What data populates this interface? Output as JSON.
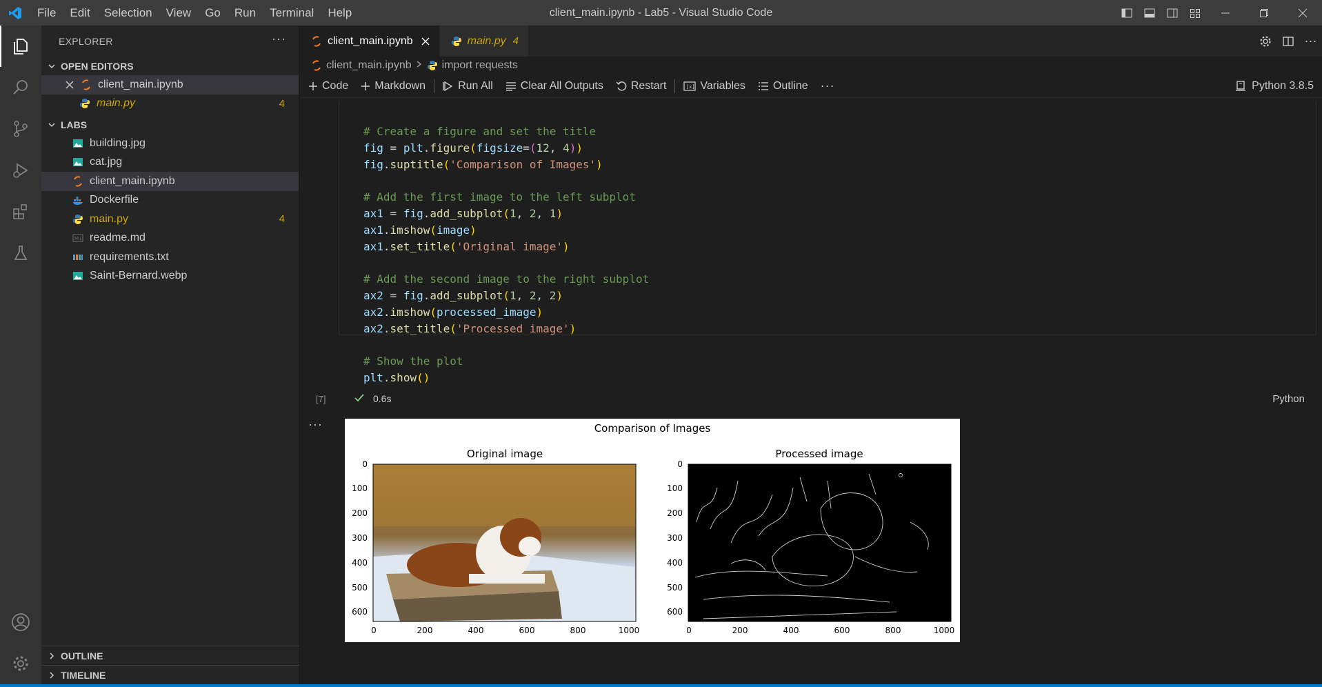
{
  "window": {
    "title": "client_main.ipynb - Lab5 - Visual Studio Code",
    "menu": [
      "File",
      "Edit",
      "Selection",
      "View",
      "Go",
      "Run",
      "Terminal",
      "Help"
    ]
  },
  "sidebar": {
    "title": "EXPLORER",
    "open_editors": {
      "label": "OPEN EDITORS",
      "items": [
        {
          "label": "client_main.ipynb",
          "icon": "notebook-icon"
        },
        {
          "label": "main.py",
          "icon": "python-icon",
          "badge": "4"
        }
      ]
    },
    "folder": {
      "label": "LABS",
      "items": [
        {
          "label": "building.jpg",
          "icon": "image-icon"
        },
        {
          "label": "cat.jpg",
          "icon": "image-icon"
        },
        {
          "label": "client_main.ipynb",
          "icon": "notebook-icon"
        },
        {
          "label": "Dockerfile",
          "icon": "docker-icon"
        },
        {
          "label": "main.py",
          "icon": "python-icon",
          "badge": "4"
        },
        {
          "label": "readme.md",
          "icon": "markdown-icon"
        },
        {
          "label": "requirements.txt",
          "icon": "requirements-icon"
        },
        {
          "label": "Saint-Bernard.webp",
          "icon": "image-icon"
        }
      ]
    },
    "outline_label": "OUTLINE",
    "timeline_label": "TIMELINE"
  },
  "tabs": [
    {
      "label": "client_main.ipynb",
      "active": true
    },
    {
      "label": "main.py",
      "badge": "4"
    }
  ],
  "breadcrumb": {
    "file": "client_main.ipynb",
    "symbol": "import requests"
  },
  "toolbar": {
    "code": "Code",
    "markdown": "Markdown",
    "run_all": "Run All",
    "clear_outputs": "Clear All Outputs",
    "restart": "Restart",
    "variables": "Variables",
    "outline": "Outline",
    "kernel": "Python 3.8.5"
  },
  "cell": {
    "execution_count": "[7]",
    "exec_time": "0.6s",
    "language": "Python",
    "code_lines": [
      "# Create a figure and set the title",
      "fig = plt.figure(figsize=(12, 4))",
      "fig.suptitle('Comparison of Images')",
      "",
      "# Add the first image to the left subplot",
      "ax1 = fig.add_subplot(1, 2, 1)",
      "ax1.imshow(image)",
      "ax1.set_title('Original image')",
      "",
      "# Add the second image to the right subplot",
      "ax2 = fig.add_subplot(1, 2, 2)",
      "ax2.imshow(processed_image)",
      "ax2.set_title('Processed image')",
      "",
      "# Show the plot",
      "plt.show()"
    ]
  },
  "output_figure": {
    "suptitle": "Comparison of Images",
    "left_title": "Original image",
    "right_title": "Processed image",
    "xticks": [
      "0",
      "200",
      "400",
      "600",
      "800",
      "1000"
    ],
    "yticks": [
      "0",
      "100",
      "200",
      "300",
      "400",
      "500",
      "600"
    ]
  },
  "colors": {
    "accent": "#007acc",
    "warning": "#cca700",
    "notebook_orange": "#f57c2a"
  }
}
